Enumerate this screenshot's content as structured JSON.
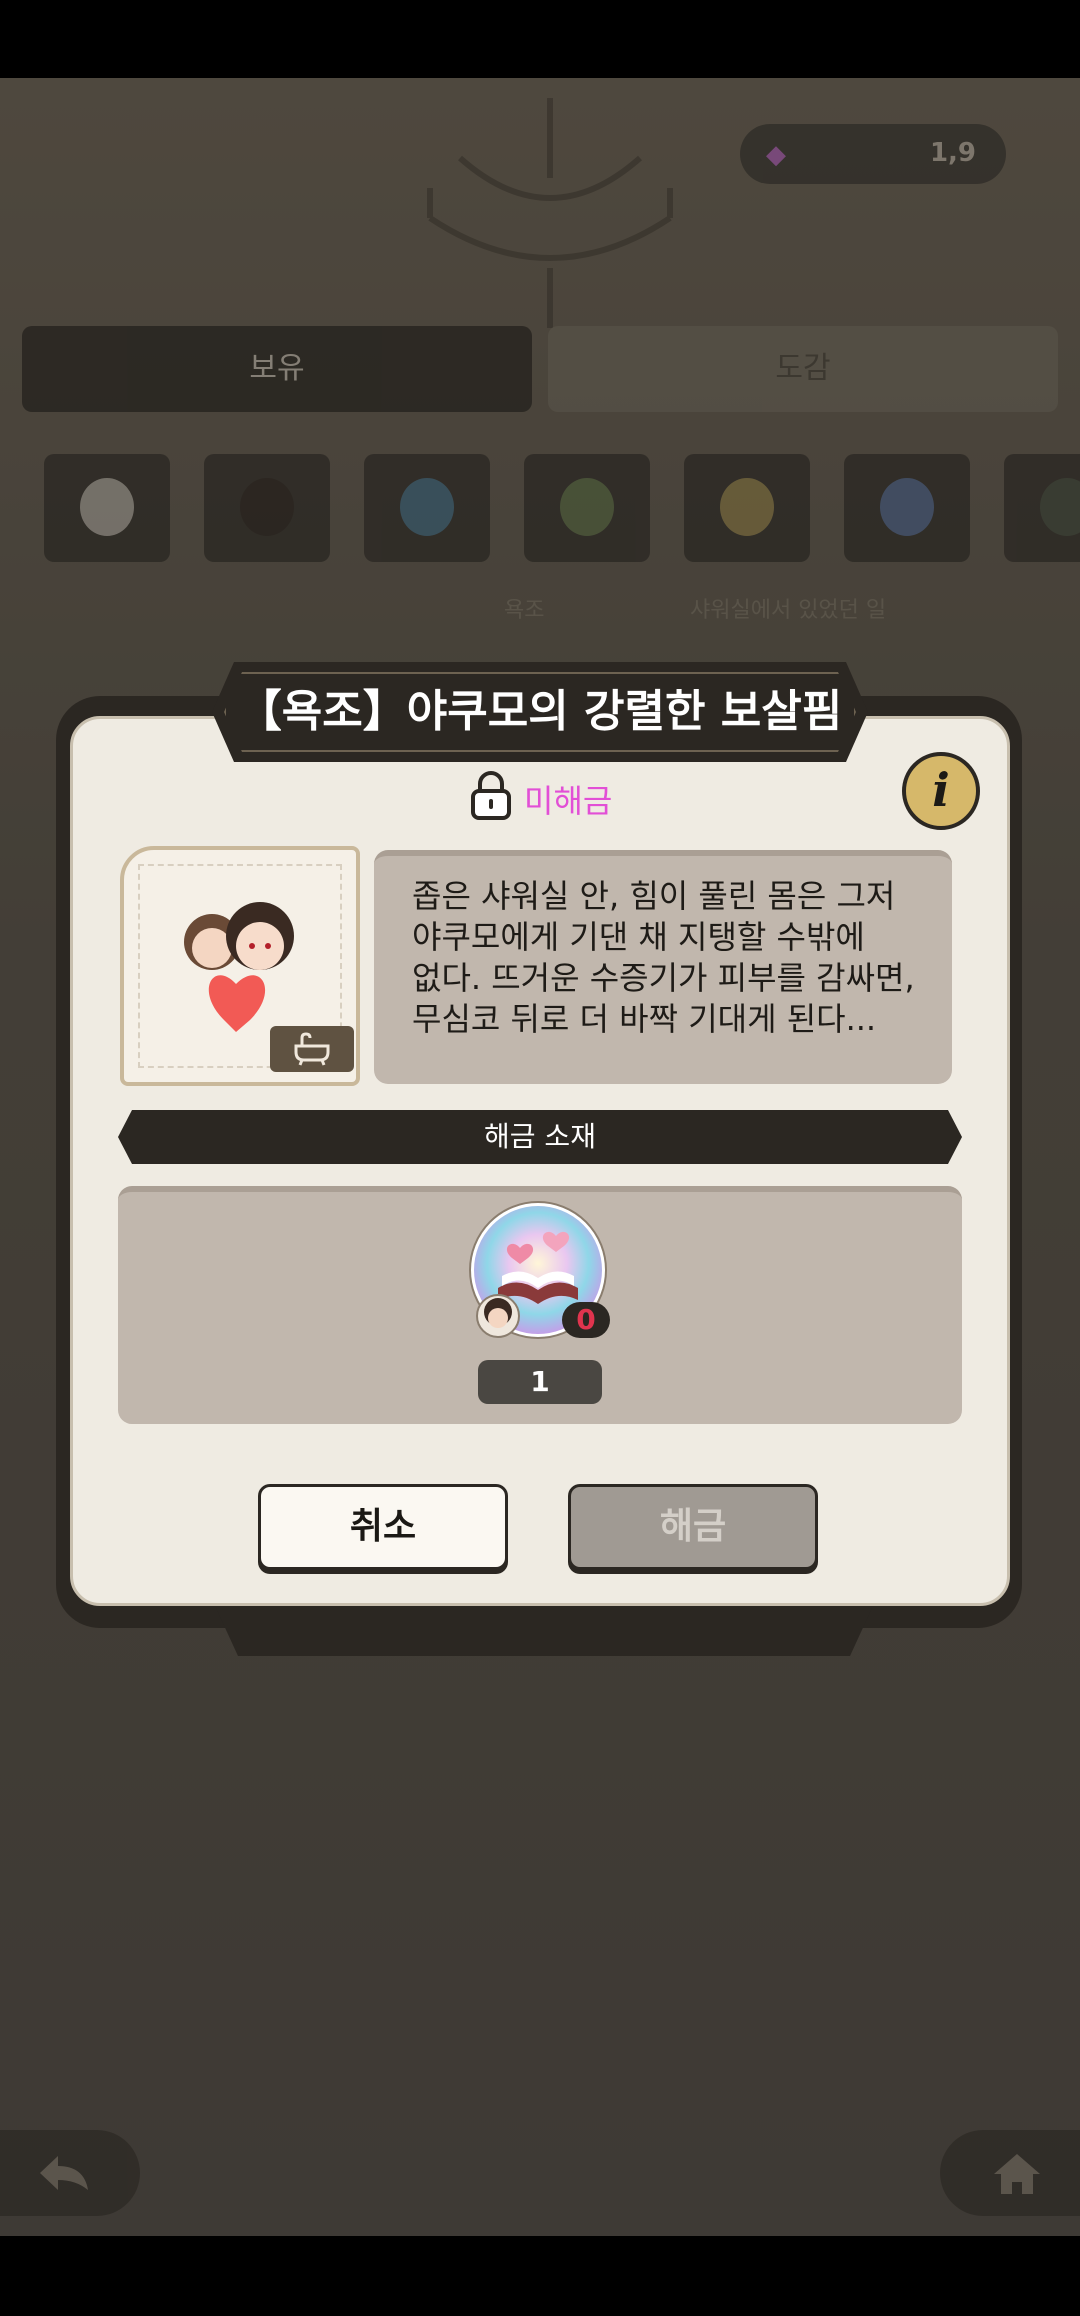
{
  "background": {
    "currency_value": "1,9",
    "tabs": [
      "보유",
      "도감"
    ],
    "slot_labels": [
      "욕조",
      "샤워실에서 있었던 일"
    ]
  },
  "dialog": {
    "title": "【욕조】야쿠모의 강렬한 보살핌",
    "lock_status": "미해금",
    "info_label": "i",
    "description": "좁은 샤워실 안, 힘이 풀린 몸은 그저\n야쿠모에게 기댄 채 지탱할 수밖에\n없다. 뜨거운 수증기가 피부를 감싸면,\n무심코 뒤로 더 바짝 기대게 된다...",
    "section_title": "해금 소재",
    "material": {
      "owned_count": "0",
      "required_qty": "1"
    },
    "buttons": {
      "cancel": "취소",
      "unlock": "해금"
    }
  },
  "colors": {
    "lock_text": "#e24fd6",
    "count_badge_text": "#e0344e",
    "info_button": "#d6b86a",
    "panel": "#efebe2",
    "frame": "#2b2722"
  },
  "icons": [
    "lock-icon",
    "info-icon",
    "bathtub-icon",
    "back-arrow-icon",
    "home-icon",
    "gem-icon"
  ]
}
